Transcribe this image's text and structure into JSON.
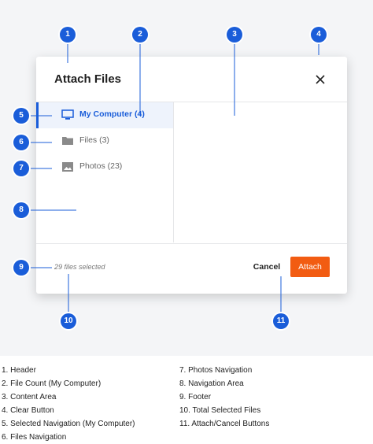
{
  "dialog": {
    "title": "Attach Files",
    "nav": [
      {
        "label": "My Computer (4)",
        "icon": "monitor-icon",
        "selected": true
      },
      {
        "label": "Files (3)",
        "icon": "folder-icon",
        "selected": false
      },
      {
        "label": "Photos (23)",
        "icon": "image-icon",
        "selected": false
      }
    ],
    "footer": {
      "selected_text": "29 files selected",
      "cancel_label": "Cancel",
      "attach_label": "Attach"
    }
  },
  "colors": {
    "accent": "#1a5dd9",
    "attach_button": "#f25c12",
    "selected_bg": "#eef3fc"
  },
  "callouts": [
    "1",
    "2",
    "3",
    "4",
    "5",
    "6",
    "7",
    "8",
    "9",
    "10",
    "11"
  ],
  "legend": {
    "left": [
      "1. Header",
      "2. File Count (My Computer)",
      "3. Content Area",
      "4. Clear Button",
      "5. Selected Navigation (My Computer)",
      "6. Files Navigation"
    ],
    "right": [
      "7. Photos Navigation",
      "8. Navigation Area",
      "9. Footer",
      "10. Total Selected Files",
      "11. Attach/Cancel Buttons"
    ]
  }
}
